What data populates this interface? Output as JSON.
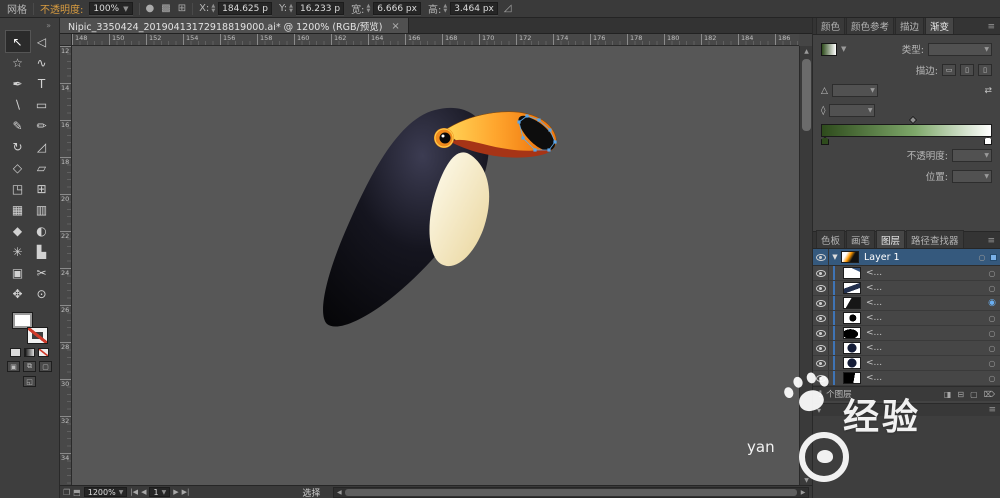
{
  "colors": {
    "accent_blue": "#3f74b5",
    "selection_blue": "#5aa5e8",
    "label_orange": "#d79b40",
    "gradient_start": "#2e4b1c",
    "gradient_end": "#ffffff",
    "canvas_gray": "#575757"
  },
  "top_bar": {
    "left_label": "网格",
    "opacity_label": "不透明度:",
    "opacity_value": "100%",
    "icons_mid": [
      {
        "name": "style-swatch-icon",
        "glyph": "●"
      },
      {
        "name": "recolor-artwork-icon",
        "glyph": "▩"
      },
      {
        "name": "align-options-icon",
        "glyph": "⊞"
      }
    ],
    "fields": [
      {
        "name": "x-field",
        "label": "X:",
        "value": "184.625 p"
      },
      {
        "name": "y-field",
        "label": "Y:",
        "value": "16.233 p"
      },
      {
        "name": "width-field",
        "label": "宽:",
        "value": "6.666 px"
      },
      {
        "name": "height-field",
        "label": "高:",
        "value": "3.464 px"
      }
    ],
    "shear_icon": "◿"
  },
  "doc_tab": {
    "title": "Nipic_3350424_20190413172918819000.ai* @ 1200% (RGB/预览)",
    "close": "×"
  },
  "toolbar": {
    "collapse_icon": "»"
  },
  "tools": [
    {
      "name": "selection-tool",
      "glyph": "↖",
      "active": true
    },
    {
      "name": "direct-selection-tool",
      "glyph": "◁"
    },
    {
      "name": "magic-wand-tool",
      "glyph": "☆"
    },
    {
      "name": "lasso-tool",
      "glyph": "∿"
    },
    {
      "name": "pen-tool",
      "glyph": "✒"
    },
    {
      "name": "type-tool",
      "glyph": "T"
    },
    {
      "name": "line-segment-tool",
      "glyph": "∖"
    },
    {
      "name": "rectangle-tool",
      "glyph": "▭"
    },
    {
      "name": "paintbrush-tool",
      "glyph": "✎"
    },
    {
      "name": "pencil-tool",
      "glyph": "✏"
    },
    {
      "name": "rotate-tool",
      "glyph": "↻"
    },
    {
      "name": "scale-tool",
      "glyph": "◿"
    },
    {
      "name": "width-tool",
      "glyph": "◇"
    },
    {
      "name": "free-transform-tool",
      "glyph": "▱"
    },
    {
      "name": "shape-builder-tool",
      "glyph": "◳"
    },
    {
      "name": "perspective-grid-tool",
      "glyph": "⊞"
    },
    {
      "name": "mesh-tool",
      "glyph": "▦"
    },
    {
      "name": "gradient-tool",
      "glyph": "▥"
    },
    {
      "name": "eyedropper-tool",
      "glyph": "◆"
    },
    {
      "name": "blend-tool",
      "glyph": "◐"
    },
    {
      "name": "symbol-sprayer-tool",
      "glyph": "✳"
    },
    {
      "name": "column-graph-tool",
      "glyph": "▙"
    },
    {
      "name": "artboard-tool",
      "glyph": "▣"
    },
    {
      "name": "slice-tool",
      "glyph": "✂"
    },
    {
      "name": "hand-tool",
      "glyph": "✥"
    },
    {
      "name": "zoom-tool",
      "glyph": "⊙"
    }
  ],
  "rulers": {
    "top": [
      "148",
      "150",
      "152",
      "154",
      "156",
      "158",
      "160",
      "162",
      "164",
      "166",
      "168",
      "170",
      "172",
      "174",
      "176",
      "178",
      "180",
      "182",
      "184",
      "186"
    ],
    "left": [
      "12",
      "14",
      "16",
      "18",
      "20",
      "22",
      "24",
      "26",
      "28",
      "30",
      "32",
      "34"
    ]
  },
  "gradient_panel": {
    "tabs": [
      {
        "name": "tab-color",
        "label": "颜色"
      },
      {
        "name": "tab-color-guide",
        "label": "颜色参考"
      },
      {
        "name": "tab-stroke",
        "label": "描边"
      },
      {
        "name": "tab-gradient",
        "label": "渐变",
        "active": true
      }
    ],
    "menu_icon": "≡",
    "type_label": "类型:",
    "stroke_label": "描边:",
    "angle_icon": "△",
    "aspect_icon": "◊",
    "reverse_icon": "⇄",
    "opacity_label": "不透明度:",
    "location_label": "位置:",
    "opacity_value": "",
    "location_value": ""
  },
  "layers_panel": {
    "tabs": [
      {
        "name": "tab-swatches",
        "label": "色板"
      },
      {
        "name": "tab-brushes",
        "label": "画笔"
      },
      {
        "name": "tab-layers",
        "label": "图层",
        "active": true
      },
      {
        "name": "tab-pathfinder",
        "label": "路径查找器"
      }
    ],
    "menu_icon": "≡",
    "expand_icon": "▼",
    "layer_name": "Layer 1",
    "items": [
      {
        "label": "<...",
        "thumb": "th-beak1"
      },
      {
        "label": "<...",
        "thumb": "th-beak2"
      },
      {
        "label": "<...",
        "thumb": "th-beak3",
        "targeted": true
      },
      {
        "label": "<...",
        "thumb": "th-dot"
      },
      {
        "label": "<...",
        "thumb": "th-blob"
      },
      {
        "label": "<...",
        "thumb": "th-circle"
      },
      {
        "label": "<...",
        "thumb": "th-circle"
      },
      {
        "label": "<...",
        "thumb": "th-dark"
      }
    ],
    "footer_label": "1 个图层",
    "footer_icons": [
      {
        "name": "make-clipping-mask-icon",
        "glyph": "◨"
      },
      {
        "name": "new-sublayer-icon",
        "glyph": "⊟"
      },
      {
        "name": "new-layer-icon",
        "glyph": "▢"
      },
      {
        "name": "delete-layer-icon",
        "glyph": "⌦"
      }
    ]
  },
  "status_bar": {
    "zoom_value": "1200%",
    "page_value": "1",
    "status_label": "选择"
  },
  "watermark": {
    "main_text": "经验",
    "partial_text": "yan"
  }
}
